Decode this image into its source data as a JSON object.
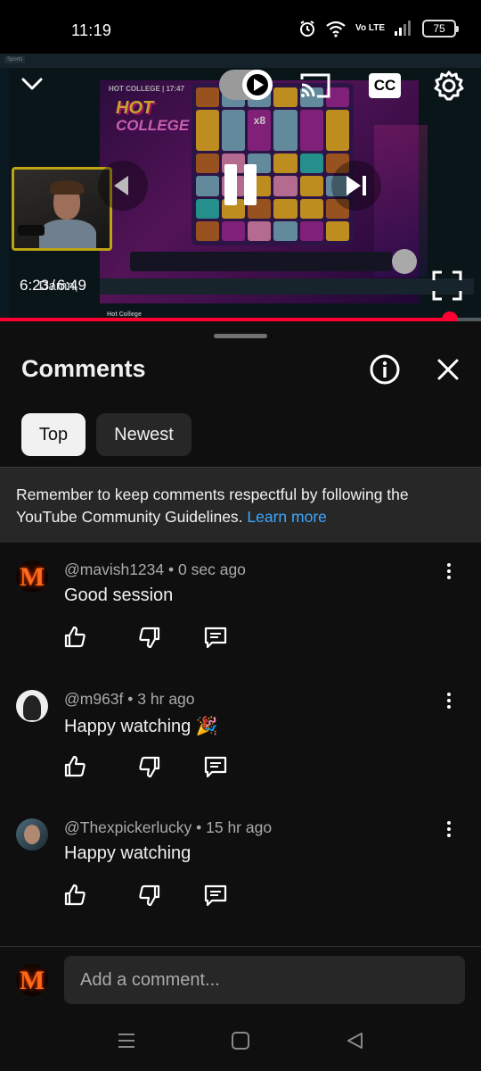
{
  "status_bar": {
    "time": "11:19",
    "network_label": "Vo LTE",
    "battery": "75",
    "icons": [
      "alarm-icon",
      "wifi-icon",
      "volte-icon",
      "signal-icon",
      "battery-icon"
    ]
  },
  "player": {
    "time_current": "6:23",
    "time_separator": "/",
    "time_total": "6:49",
    "caption_text": "Damn,",
    "progress_fraction": 0.936,
    "cc_label": "CC",
    "controls": [
      "collapse-icon",
      "autoplay-toggle",
      "cast-icon",
      "cc-button",
      "settings-icon",
      "previous-icon",
      "pause-icon",
      "next-icon",
      "fullscreen-icon"
    ],
    "in_video": {
      "site_tab": "Sports",
      "game_title": "HOT COLLEGE | 17:47",
      "logo_line1": "HOT",
      "logo_line2": "COLLEGE",
      "multiplier": "x8",
      "page_footer": "Hot College"
    }
  },
  "comments_panel": {
    "title": "Comments",
    "filters": [
      {
        "label": "Top",
        "selected": true
      },
      {
        "label": "Newest",
        "selected": false
      }
    ],
    "notice": {
      "text": "Remember to keep comments respectful by following the YouTube Community Guidelines.",
      "link": "Learn more"
    },
    "comments": [
      {
        "author": "@mavish1234",
        "age": "0 sec ago",
        "text": "Good session",
        "avatar": "flame-m-avatar"
      },
      {
        "author": "@m963f",
        "age": "3 hr ago",
        "text": "Happy watching 🎉",
        "avatar": "silhouette-avatar"
      },
      {
        "author": "@Thexpickerlucky",
        "age": "15 hr ago",
        "text": "Happy watching",
        "avatar": "photo-avatar"
      }
    ],
    "meta_separator": "•",
    "add_comment_placeholder": "Add a comment..."
  },
  "colors": {
    "background": "#0f0f0f",
    "accent_red": "#ff0033",
    "link_blue": "#3ea6ff",
    "chip_selected": "#f1f1f1",
    "chip_default": "#272727",
    "secondary_text": "#aaaaaa"
  }
}
